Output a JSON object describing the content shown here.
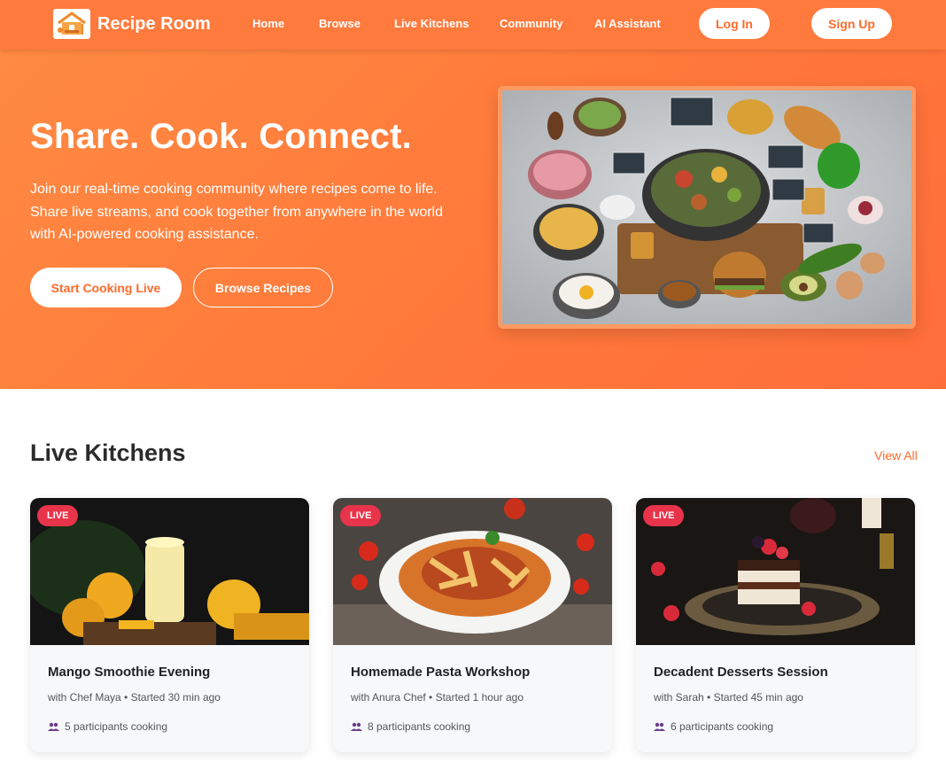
{
  "brand": {
    "name": "Recipe Room",
    "logo_icon": "kitchen-house-icon"
  },
  "nav": {
    "links": [
      "Home",
      "Browse",
      "Live Kitchens",
      "Community",
      "AI Assistant"
    ],
    "login_label": "Log In",
    "signup_label": "Sign Up"
  },
  "hero": {
    "title": "Share. Cook. Connect.",
    "lead": "Join our real-time cooking community where recipes come to life. Share live streams, and cook together from anywhere in the world with AI-powered cooking assistance.",
    "primary_label": "Start Cooking Live",
    "secondary_label": "Browse Recipes"
  },
  "section": {
    "title": "Live Kitchens",
    "view_all": "View All"
  },
  "cards": [
    {
      "badge": "LIVE",
      "title": "Mango Smoothie Evening",
      "meta": "with Chef Maya • Started 30 min ago",
      "participants": "5 participants cooking"
    },
    {
      "badge": "LIVE",
      "title": "Homemade Pasta Workshop",
      "meta": "with Anura Chef • Started 1 hour ago",
      "participants": "8 participants cooking"
    },
    {
      "badge": "LIVE",
      "title": "Decadent Desserts Session",
      "meta": "with Sarah • Started 45 min ago",
      "participants": "6 participants cooking"
    }
  ],
  "colors": {
    "accent": "#ff7a3d",
    "live": "#e8344a",
    "card_bg": "#f7f8fa"
  }
}
